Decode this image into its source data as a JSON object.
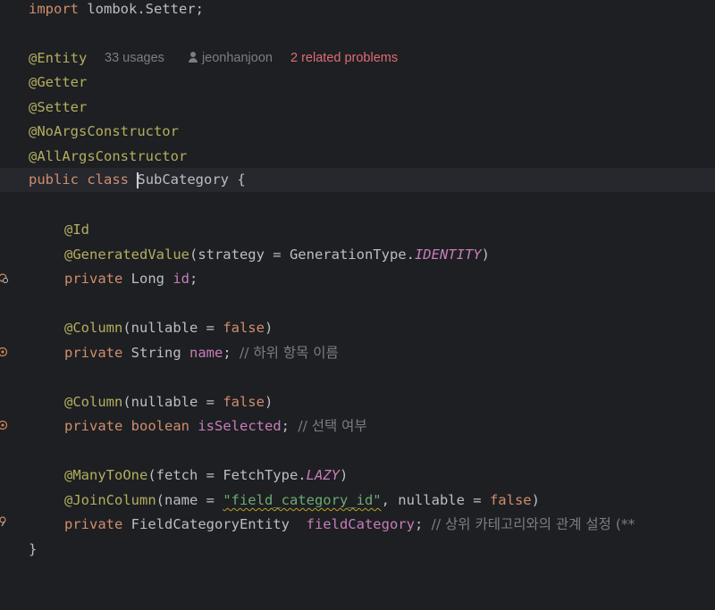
{
  "editor": {
    "inlay": {
      "usages": "33 usages",
      "author": "jeonhanjoon",
      "problems": "2 related problems"
    },
    "tokens": {
      "import_kw": "import",
      "import_path": " lombok.Setter;",
      "entity": "@Entity",
      "getter": "@Getter",
      "setter": "@Setter",
      "noargs": "@NoArgsConstructor",
      "allargs": "@AllArgsConstructor",
      "public": "public",
      "class": "class",
      "class_name": "SubCategory",
      "brace_open": " {",
      "id_ann": "@Id",
      "gen_ann": "@GeneratedValue",
      "gen_args": "(strategy = GenerationType.",
      "identity": "IDENTITY",
      "close_paren": ")",
      "private": "private",
      "long_type": " Long ",
      "id_field": "id",
      "semicolon": ";",
      "column_ann": "@Column",
      "nullable_args": "(nullable = ",
      "false_kw": "false",
      "string_type": " String ",
      "name_field": "name",
      "name_comment": "// 하위 항목 이름",
      "boolean_kw": "boolean",
      "is_selected_field": "isSelected",
      "selected_comment": "// 선택 여부",
      "many_to_one_ann": "@ManyToOne",
      "fetch_args": "(fetch = FetchType.",
      "lazy": "LAZY",
      "join_column_ann": "@JoinColumn",
      "name_args": "(name = ",
      "join_name_str": "\"field_category_id\"",
      "nullable_tail": ", nullable = ",
      "entity_type": " FieldCategoryEntity  ",
      "field_category_field": "fieldCategory",
      "category_comment": "// 상위 카테고리와의 관계 설정 (**",
      "brace_close": "}"
    },
    "gutter_icons": [
      "bean-class-icon",
      "id-field-icon",
      "column-field-icon",
      "column-field-icon-2",
      "relation-field-icon"
    ]
  }
}
